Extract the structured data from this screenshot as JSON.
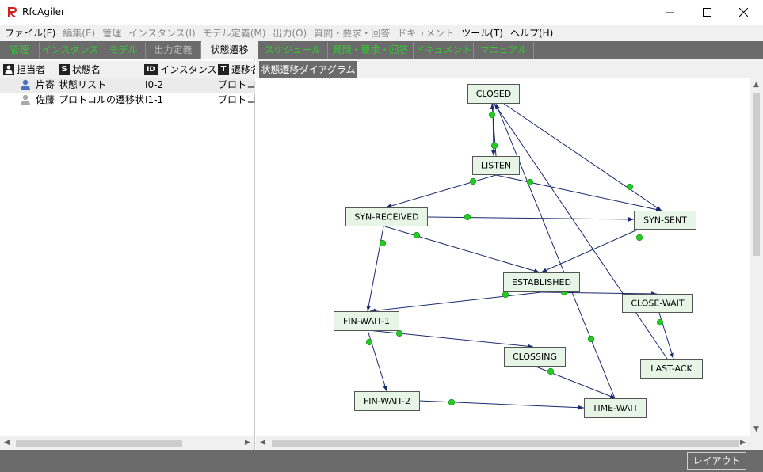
{
  "window": {
    "title": "RfcAgiler"
  },
  "menu": [
    {
      "label": "ファイル(F)",
      "enabled": true
    },
    {
      "label": "編集(E)",
      "enabled": false
    },
    {
      "label": "管理",
      "enabled": false
    },
    {
      "label": "インスタンス(I)",
      "enabled": false
    },
    {
      "label": "モデル定義(M)",
      "enabled": false
    },
    {
      "label": "出力(O)",
      "enabled": false
    },
    {
      "label": "質問・要求・回答",
      "enabled": false
    },
    {
      "label": "ドキュメント",
      "enabled": false
    },
    {
      "label": "ツール(T)",
      "enabled": true
    },
    {
      "label": "ヘルプ(H)",
      "enabled": true
    }
  ],
  "tabs": [
    {
      "label": "管理",
      "state": "normal"
    },
    {
      "label": "インスタンス",
      "state": "normal"
    },
    {
      "label": "モデル",
      "state": "normal"
    },
    {
      "label": "出力定義",
      "state": "disabled"
    },
    {
      "label": "状態遷移",
      "state": "active"
    },
    {
      "label": "スケジュール",
      "state": "normal"
    },
    {
      "label": "質問・要求・回答",
      "state": "normal"
    },
    {
      "label": "ドキュメント",
      "state": "normal"
    },
    {
      "label": "マニュアル",
      "state": "normal"
    }
  ],
  "list": {
    "columns": [
      {
        "icon": "person",
        "label": "担当者"
      },
      {
        "icon": "S",
        "label": "状態名"
      },
      {
        "icon": "ID",
        "label": "インスタンスID"
      },
      {
        "icon": "T",
        "label": "遷移名"
      }
    ],
    "rows": [
      {
        "assignee": "片寄",
        "state_name": "状態リスト",
        "instance_id": "I0-2",
        "transition": "プロトコル",
        "selected": true,
        "avatar_color": "#4a6fc4"
      },
      {
        "assignee": "佐藤",
        "state_name": "プロトコルの遷移状態",
        "instance_id": "I1-1",
        "transition": "プロトコル",
        "selected": false,
        "avatar_color": "#a8a8a8"
      }
    ]
  },
  "diagram": {
    "tab_label": "状態遷移ダイアグラム",
    "states": [
      {
        "id": "closed",
        "label": "CLOSED"
      },
      {
        "id": "listen",
        "label": "LISTEN"
      },
      {
        "id": "syn_received",
        "label": "SYN-RECEIVED"
      },
      {
        "id": "syn_sent",
        "label": "SYN-SENT"
      },
      {
        "id": "established",
        "label": "ESTABLISHED"
      },
      {
        "id": "close_wait",
        "label": "CLOSE-WAIT"
      },
      {
        "id": "fin_wait_1",
        "label": "FIN-WAIT-1"
      },
      {
        "id": "closing",
        "label": "CLOSSING"
      },
      {
        "id": "last_ack",
        "label": "LAST-ACK"
      },
      {
        "id": "fin_wait_2",
        "label": "FIN-WAIT-2"
      },
      {
        "id": "time_wait",
        "label": "TIME-WAIT"
      }
    ],
    "transitions": [
      [
        "closed",
        "listen"
      ],
      [
        "listen",
        "closed"
      ],
      [
        "closed",
        "syn_sent"
      ],
      [
        "listen",
        "syn_received"
      ],
      [
        "listen",
        "syn_sent"
      ],
      [
        "syn_received",
        "syn_sent"
      ],
      [
        "syn_received",
        "established"
      ],
      [
        "syn_sent",
        "established"
      ],
      [
        "syn_received",
        "fin_wait_1"
      ],
      [
        "established",
        "fin_wait_1"
      ],
      [
        "established",
        "close_wait"
      ],
      [
        "close_wait",
        "last_ack"
      ],
      [
        "last_ack",
        "closed"
      ],
      [
        "fin_wait_1",
        "closing"
      ],
      [
        "fin_wait_1",
        "fin_wait_2"
      ],
      [
        "closing",
        "time_wait"
      ],
      [
        "fin_wait_2",
        "time_wait"
      ],
      [
        "time_wait",
        "closed"
      ]
    ]
  },
  "status": {
    "layout_button": "レイアウト"
  }
}
